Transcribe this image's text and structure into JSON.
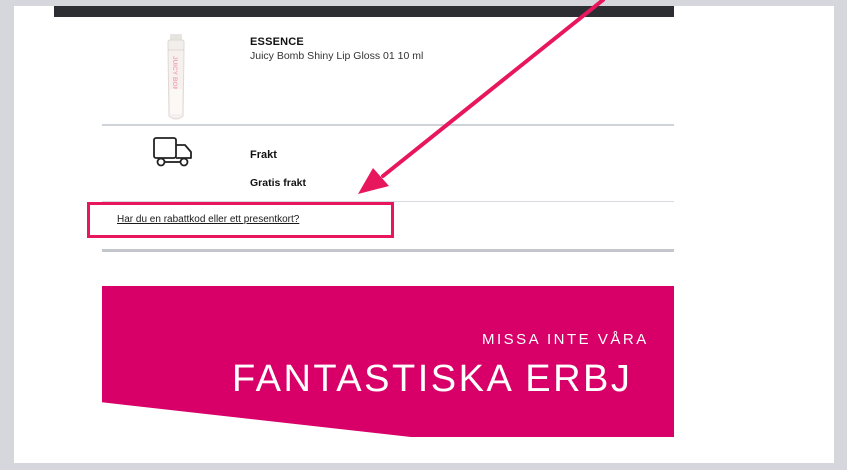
{
  "cart": {
    "item": {
      "brand": "ESSENCE",
      "name": "Juicy Bomb Shiny Lip Gloss 01 10 ml",
      "image_label": "JUICY BOMB"
    },
    "shipping": {
      "title": "Frakt",
      "value": "Gratis frakt"
    },
    "promo_link": "Har du en rabattkod eller ett presentkort?"
  },
  "banner": {
    "line1": "MISSA INTE VÅRA",
    "line2": "FANTASTISKA ERBJ",
    "color": "#d80068"
  },
  "annotation": {
    "color": "#e8175d"
  },
  "icons": {
    "product": "lip-gloss-tube-icon",
    "shipping": "truck-icon"
  }
}
